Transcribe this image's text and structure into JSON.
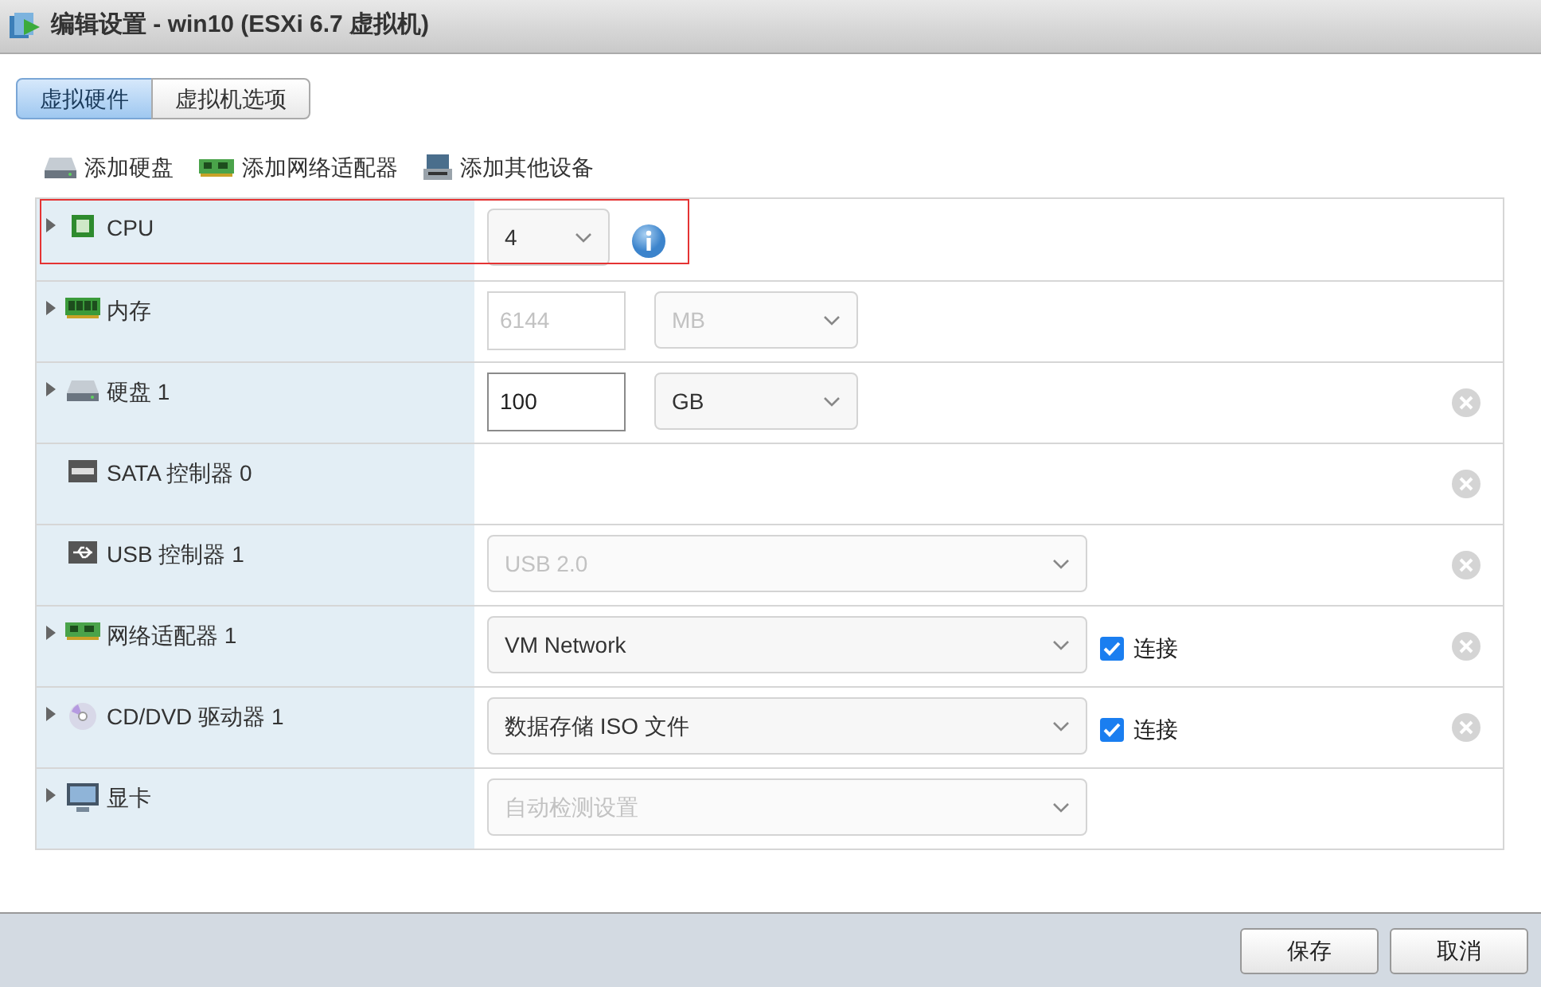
{
  "window": {
    "title": "编辑设置 - win10 (ESXi 6.7 虚拟机)"
  },
  "tabs": [
    {
      "label": "虚拟硬件",
      "selected": true
    },
    {
      "label": "虚拟机选项",
      "selected": false
    }
  ],
  "toolbar": [
    {
      "kind": "disk",
      "label": "添加硬盘"
    },
    {
      "kind": "nic",
      "label": "添加网络适配器"
    },
    {
      "kind": "device",
      "label": "添加其他设备"
    }
  ],
  "devices": [
    {
      "kind": "cpu",
      "label": "CPU",
      "expandable": true,
      "highlighted": true,
      "removable": false,
      "controls": [
        {
          "kind": "count",
          "value": "4",
          "disabled": false
        },
        {
          "kind": "info"
        }
      ]
    },
    {
      "kind": "memory",
      "label": "内存",
      "expandable": true,
      "highlighted": false,
      "removable": false,
      "controls": [
        {
          "kind": "number",
          "value": "6144",
          "disabled": true
        },
        {
          "kind": "unit",
          "value": "MB",
          "disabled": true
        }
      ]
    },
    {
      "kind": "disk",
      "label": "硬盘 1",
      "expandable": true,
      "highlighted": false,
      "removable": true,
      "controls": [
        {
          "kind": "number",
          "value": "100",
          "disabled": false
        },
        {
          "kind": "unit",
          "value": "GB",
          "disabled": false
        }
      ]
    },
    {
      "kind": "sata",
      "label": "SATA 控制器 0",
      "expandable": false,
      "highlighted": false,
      "removable": true
    },
    {
      "kind": "usb",
      "label": "USB 控制器 1",
      "expandable": false,
      "highlighted": false,
      "removable": true,
      "controls": [
        {
          "kind": "select",
          "value": "USB 2.0",
          "disabled": true
        }
      ]
    },
    {
      "kind": "nic",
      "label": "网络适配器 1",
      "expandable": true,
      "highlighted": false,
      "removable": true,
      "controls": [
        {
          "kind": "select",
          "value": "VM Network",
          "disabled": false
        },
        {
          "kind": "checkbox",
          "label": "连接",
          "checked": true
        }
      ]
    },
    {
      "kind": "cd",
      "label": "CD/DVD 驱动器 1",
      "expandable": true,
      "highlighted": false,
      "removable": true,
      "controls": [
        {
          "kind": "select",
          "value": "数据存储 ISO 文件",
          "disabled": false
        },
        {
          "kind": "checkbox",
          "label": "连接",
          "checked": true
        }
      ]
    },
    {
      "kind": "display",
      "label": "显卡",
      "expandable": true,
      "highlighted": false,
      "removable": false,
      "controls": [
        {
          "kind": "select",
          "value": "自动检测设置",
          "disabled": true
        }
      ]
    }
  ],
  "buttons": [
    {
      "label": "保存"
    },
    {
      "label": "取消"
    }
  ]
}
